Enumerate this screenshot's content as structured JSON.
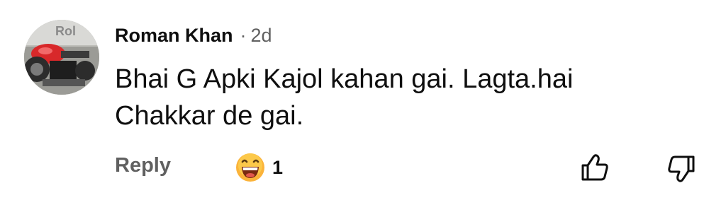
{
  "comment": {
    "author": "Roman Khan",
    "separator": "·",
    "time": "2d",
    "text_lines": [
      "Bhai G Apki Kajol kahan gai. Lagta.hai",
      "Chakkar de gai."
    ],
    "reply_label": "Reply",
    "reaction": {
      "icon": "grinning-face-emoji-icon",
      "count": "1"
    },
    "avatar_text": "Rol"
  },
  "colors": {
    "text_primary": "#0f0f0f",
    "text_secondary": "#606060",
    "background": "#ffffff",
    "emoji_face": "#fbb33a"
  }
}
